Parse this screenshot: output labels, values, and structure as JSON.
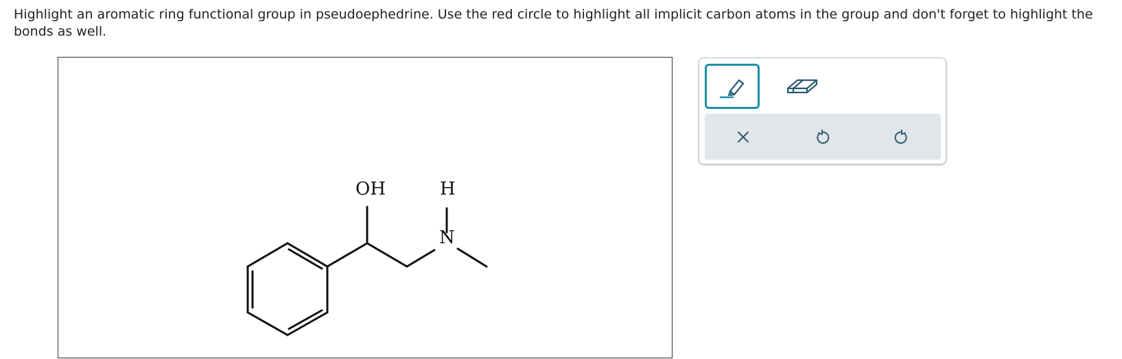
{
  "question": {
    "text": "Highlight an aromatic ring functional group in pseudoephedrine. Use the red circle to highlight all implicit carbon atoms in the group and don't forget to highlight the bonds as well."
  },
  "molecule": {
    "name": "pseudoephedrine",
    "labels": {
      "hydroxyl": "OH",
      "amine_h": "H",
      "nitrogen": "N"
    }
  },
  "toolbar": {
    "tools": [
      {
        "name": "highlighter",
        "icon": "highlighter-icon",
        "selected": true
      },
      {
        "name": "eraser",
        "icon": "eraser-icon",
        "selected": false
      }
    ],
    "actions": [
      {
        "name": "clear",
        "icon": "close-icon"
      },
      {
        "name": "undo",
        "icon": "undo-icon"
      },
      {
        "name": "redo",
        "icon": "redo-icon"
      }
    ]
  },
  "colors": {
    "accent": "#1b8fa8",
    "icon": "#2a5a6e",
    "action_bar_bg": "#e1e6ea",
    "bond": "#111111"
  }
}
